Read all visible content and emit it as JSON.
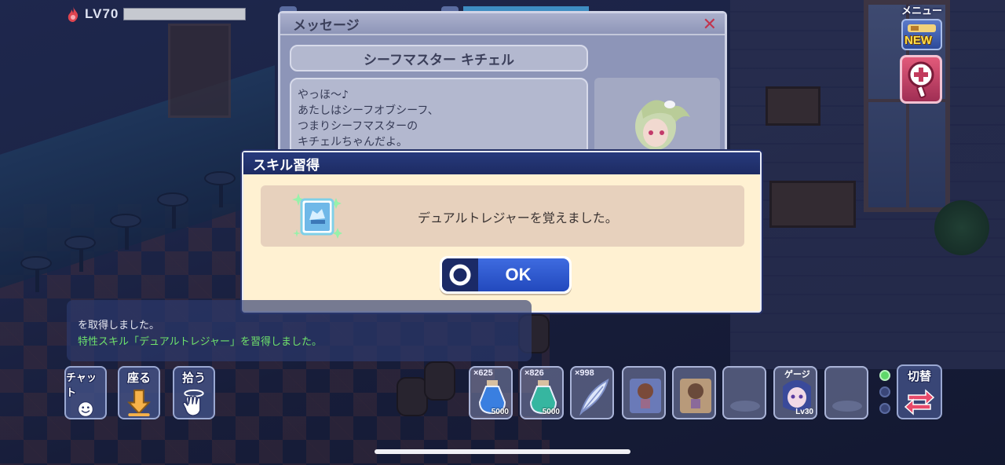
{
  "hud": {
    "level": "LV70"
  },
  "menu": {
    "label": "メニュー",
    "badge": "NEW"
  },
  "message_window": {
    "title": "メッセージ",
    "speaker": "シーフマスター キチェル",
    "lines": [
      "やっほ～♪",
      "あたしはシーフオブシーフ、",
      "つまりシーフマスターの",
      "キチェルちゃんだよ。"
    ]
  },
  "skill_dialog": {
    "title": "スキル習得",
    "message": "デュアルトレジャーを覚えました。",
    "ok_label": "OK"
  },
  "chat_log": {
    "lines": [
      {
        "text": "を取得しました。",
        "color": "#e7e9f2"
      },
      {
        "text": "特性スキル「デュアルトレジャー」を習得しました。",
        "color": "#6fe36c"
      }
    ]
  },
  "actions": {
    "chat": "チャット",
    "sit": "座る",
    "pickup": "拾う"
  },
  "items": [
    {
      "count": "×625",
      "sub": "5000",
      "kind": "potion-blue"
    },
    {
      "count": "×826",
      "sub": "5000",
      "kind": "potion-green"
    },
    {
      "count": "×998",
      "sub": "",
      "kind": "feather"
    },
    {
      "count": "",
      "sub": "",
      "kind": "character-icon"
    },
    {
      "count": "",
      "sub": "",
      "kind": "character-icon-2"
    },
    {
      "count": "",
      "sub": "",
      "kind": "empty"
    },
    {
      "count": "ゲージ",
      "sub": "Lv30",
      "kind": "pet"
    },
    {
      "count": "",
      "sub": "",
      "kind": "empty"
    }
  ],
  "switch": {
    "label": "切替",
    "active_page": 1,
    "pages": 3
  },
  "colors": {
    "dialog_header": "#1d2b63",
    "dialog_body": "#fff1d2",
    "ok_button": "#2f5ad4",
    "log_green": "#6fe36c",
    "close_x": "#c2354e"
  }
}
